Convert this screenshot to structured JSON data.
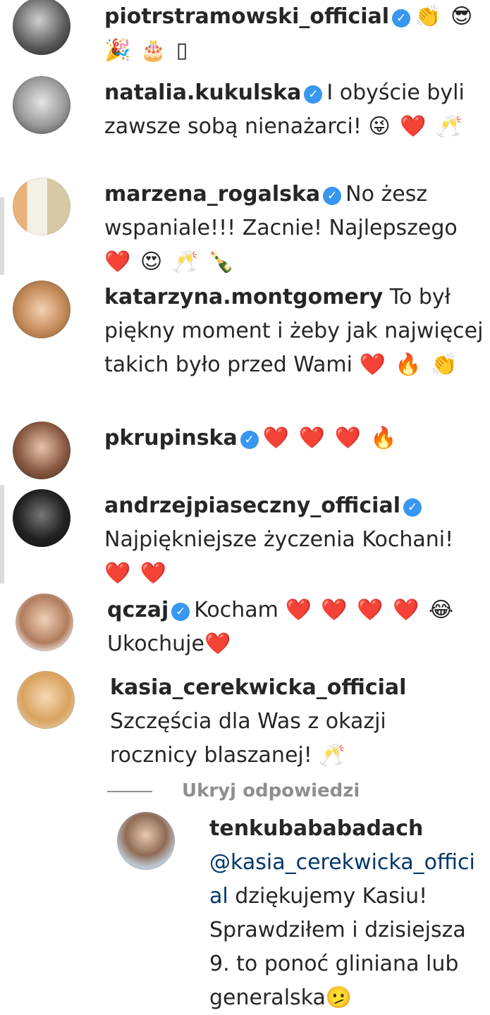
{
  "comments": [
    {
      "user": "piotrstramowski_official",
      "verified": true,
      "text": "",
      "emojis": "👏 😎 🎉 🎂 ▯"
    },
    {
      "user": "natalia.kukulska",
      "verified": true,
      "text": "I obyście byli zawsze sobą nienażarci!",
      "emojis": "😜 ❤️ 🥂"
    },
    {
      "user": "marzena_rogalska",
      "verified": true,
      "text": "No żesz wspaniale!!! Zacnie! Najlepszego",
      "emojis": "❤️ 😍 🥂 🍾"
    },
    {
      "user": "katarzyna.montgomery",
      "verified": false,
      "text": "To był piękny moment i żeby jak najwięcej takich było przed Wami",
      "emojis": "❤️ 🔥 👏"
    },
    {
      "user": "pkrupinska",
      "verified": true,
      "text": "",
      "emojis": "❤️ ❤️ ❤️ 🔥"
    },
    {
      "user": "andrzejpiaseczny_official",
      "verified": true,
      "text": "Najpiękniejsze życzenia Kochani!",
      "emojis": "❤️ ❤️"
    },
    {
      "user": "qczaj",
      "verified": true,
      "text": "Kocham",
      "emojis": "❤️ ❤️ ❤️ ❤️ 😂",
      "text2": "Ukochuje",
      "emojis2": "❤️"
    },
    {
      "user": "kasia_cerekwicka_official",
      "verified": false,
      "text": "Szczęścia dla Was z okazji rocznicy blaszanej!",
      "emojis": "🥂"
    }
  ],
  "hide_replies_label": "Ukryj odpowiedzi",
  "reply": {
    "user": "tenkubababadach",
    "mention": "@kasia_cerekwicka_official",
    "text": "dziękujemy Kasiu! Sprawdziłem i dzisiejsza 9. to ponoć gliniana lub generalska",
    "emojis": "🫤"
  },
  "verified_glyph": "✓",
  "colors": {
    "verified": "#3897f0",
    "mention": "#00376b",
    "muted": "#8e8e8e"
  }
}
